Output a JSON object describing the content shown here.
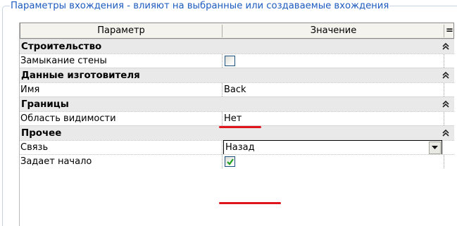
{
  "panel": {
    "title": "Параметры вхождения - влияют на выбранные или создаваемые вхождения"
  },
  "grid": {
    "headers": {
      "parameter": "Параметр",
      "value": "Значение",
      "sort_glyph": "="
    },
    "groups": [
      {
        "label": "Строительство",
        "rows": [
          {
            "name": "Замыкание стены",
            "type": "checkbox",
            "checked": false
          }
        ]
      },
      {
        "label": "Данные изготовителя",
        "rows": [
          {
            "name": "Имя",
            "type": "text",
            "value": "Back"
          }
        ]
      },
      {
        "label": "Границы",
        "rows": [
          {
            "name": "Область видимости",
            "type": "text",
            "value": "Нет"
          }
        ]
      },
      {
        "label": "Прочее",
        "rows": [
          {
            "name": "Связь",
            "type": "select",
            "value": "Назад"
          },
          {
            "name": "Задает начало",
            "type": "checkbox",
            "checked": true
          }
        ]
      }
    ]
  },
  "colors": {
    "title_blue": "#1d5bbf",
    "annotation_red": "#e0141c",
    "check_green": "#21a121"
  },
  "icons": {
    "collapse": "double-chevron-up-icon",
    "dropdown": "chevron-down-icon",
    "check": "checkmark-icon"
  }
}
